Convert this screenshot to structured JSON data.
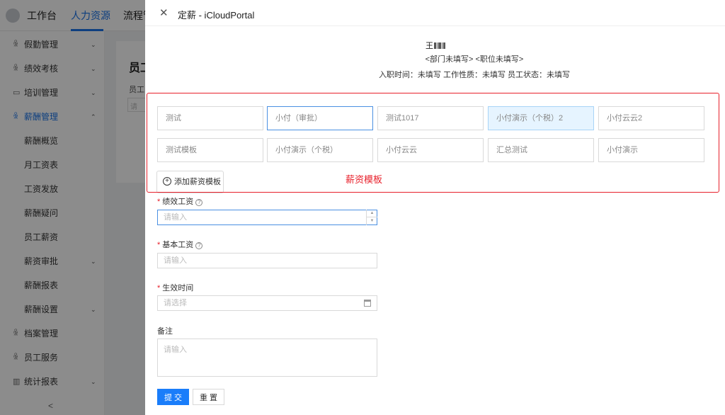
{
  "app": {
    "nav": [
      "工作台",
      "人力资源",
      "流程管"
    ],
    "sidebar": [
      {
        "label": "假勤管理",
        "icon": "people-icon",
        "chevron": "⌄"
      },
      {
        "label": "绩效考核",
        "icon": "people-icon",
        "chevron": "⌄"
      },
      {
        "label": "培训管理",
        "icon": "card-icon",
        "chevron": "⌄"
      },
      {
        "label": "薪酬管理",
        "icon": "people-icon",
        "chevron": "⌃"
      },
      {
        "label": "薪酬概览"
      },
      {
        "label": "月工资表"
      },
      {
        "label": "工资发放"
      },
      {
        "label": "薪酬疑问"
      },
      {
        "label": "员工薪资"
      },
      {
        "label": "薪资审批",
        "chevron": "⌄"
      },
      {
        "label": "薪酬报表"
      },
      {
        "label": "薪酬设置",
        "chevron": "⌄"
      },
      {
        "label": "档案管理",
        "icon": "people-icon"
      },
      {
        "label": "员工服务",
        "icon": "people-icon"
      },
      {
        "label": "统计报表",
        "icon": "chart-icon",
        "chevron": "⌄"
      }
    ],
    "collapse_glyph": "<",
    "content_title": "员工",
    "content_sub": "员工",
    "content_input_placeholder": "请"
  },
  "drawer": {
    "close_glyph": "✕",
    "title": "定薪 - iCloudPortal",
    "employee_name": "王",
    "employee_dept": "<部门未填写>  <职位未填写>",
    "employee_meta": "入职时间：未填写  工作性质：未填写  员工状态：未填写",
    "templates": [
      {
        "label": "测试",
        "state": "normal"
      },
      {
        "label": "小付（审批）",
        "state": "focused"
      },
      {
        "label": "测试1017",
        "state": "normal"
      },
      {
        "label": "小付演示（个税）2",
        "state": "selected"
      },
      {
        "label": "小付云云2",
        "state": "normal"
      },
      {
        "label": "测试模板",
        "state": "normal"
      },
      {
        "label": "小付演示（个税）",
        "state": "normal"
      },
      {
        "label": "小付云云",
        "state": "normal"
      },
      {
        "label": "汇总测试",
        "state": "normal"
      },
      {
        "label": "小付演示",
        "state": "normal"
      }
    ],
    "add_template_label": "添加薪资模板",
    "annotation_label": "薪资模板",
    "fields": {
      "performance_label": "绩效工资",
      "performance_placeholder": "请输入",
      "base_label": "基本工资",
      "base_placeholder": "请输入",
      "effective_label": "生效时间",
      "effective_placeholder": "请选择",
      "remark_label": "备注",
      "remark_placeholder": "请输入",
      "required_mark": "*",
      "help_glyph": "?"
    },
    "submit_label": "提 交",
    "reset_label": "重 置"
  },
  "colors": {
    "accent": "#1a7dfa",
    "annotation": "#e8202b",
    "selected_bg": "#e6f4ff"
  }
}
